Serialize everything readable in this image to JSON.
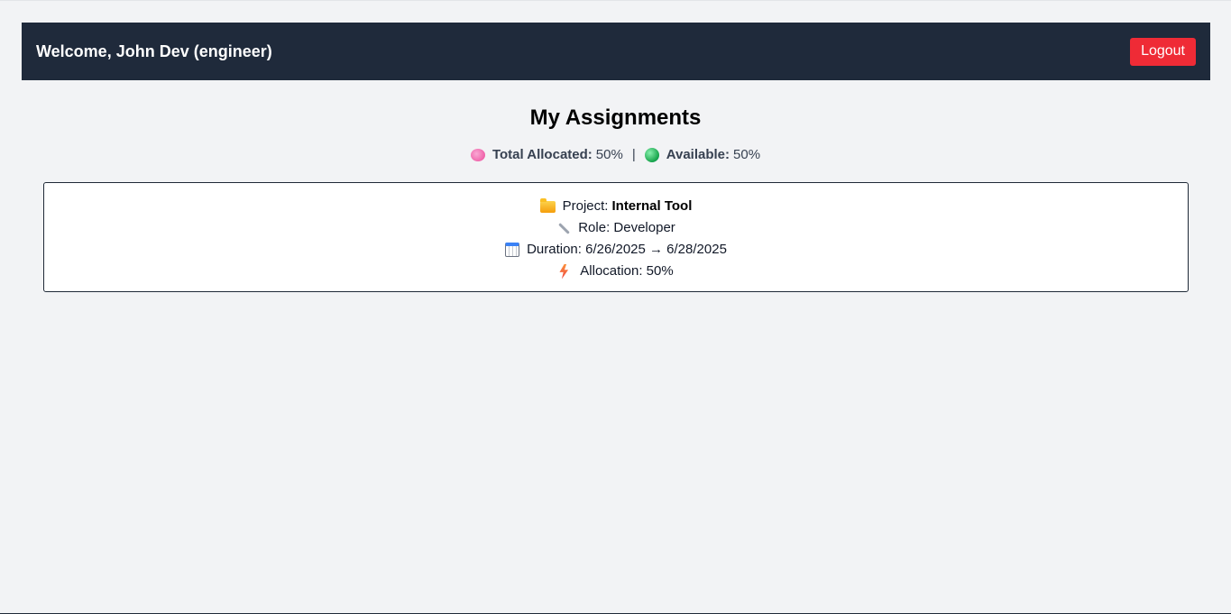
{
  "header": {
    "welcome": "Welcome, John Dev (engineer)",
    "logout_label": "Logout"
  },
  "main": {
    "title": "My Assignments",
    "summary": {
      "allocated_label": "Total Allocated:",
      "allocated_value": "50%",
      "separator": "|",
      "available_label": "Available:",
      "available_value": "50%"
    }
  },
  "assignments": [
    {
      "project_label": "Project:",
      "project_name": "Internal Tool",
      "role_text": "Role: Developer",
      "duration_text": "Duration: 6/26/2025 → 6/28/2025",
      "allocation_text": "Allocation: 50%"
    }
  ],
  "icons": {
    "allocated": "brain-icon",
    "available": "globe-icon",
    "project": "folder-icon",
    "role": "wrench-icon",
    "duration": "calendar-icon",
    "allocation": "lightning-icon"
  },
  "colors": {
    "header_bg": "#1f2a3b",
    "logout_bg": "#ef2b36",
    "page_bg": "#f2f3f5"
  }
}
